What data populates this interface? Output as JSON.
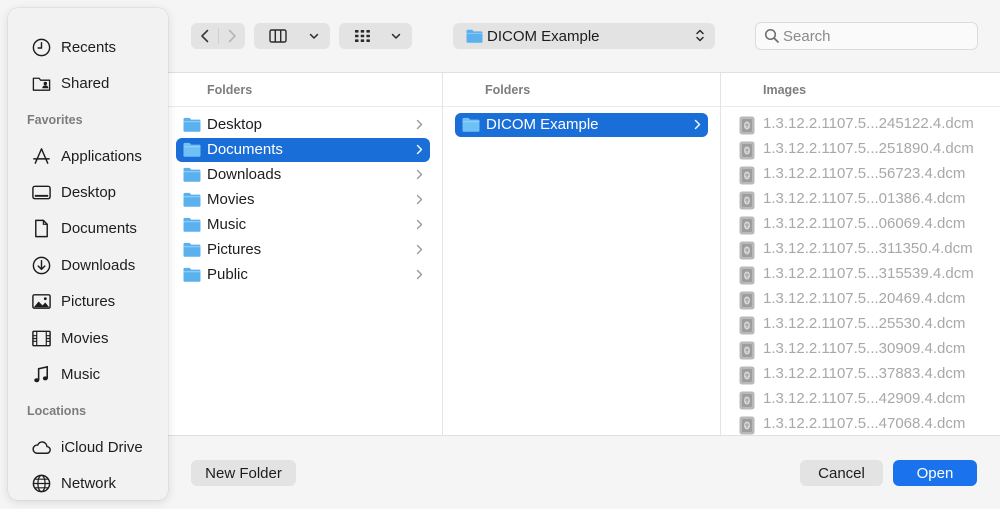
{
  "sidebar": {
    "top_items": [
      {
        "label": "Recents",
        "icon": "clock-icon"
      },
      {
        "label": "Shared",
        "icon": "shared-folder-icon"
      }
    ],
    "favorites_heading": "Favorites",
    "favorites": [
      {
        "label": "Applications",
        "icon": "applications-icon"
      },
      {
        "label": "Desktop",
        "icon": "desktop-icon"
      },
      {
        "label": "Documents",
        "icon": "document-icon"
      },
      {
        "label": "Downloads",
        "icon": "downloads-icon"
      },
      {
        "label": "Pictures",
        "icon": "pictures-icon"
      },
      {
        "label": "Movies",
        "icon": "film-icon"
      },
      {
        "label": "Music",
        "icon": "music-note-icon"
      }
    ],
    "locations_heading": "Locations",
    "locations": [
      {
        "label": "iCloud Drive",
        "icon": "cloud-icon"
      },
      {
        "label": "Network",
        "icon": "globe-icon"
      }
    ]
  },
  "toolbar": {
    "path_label": "DICOM Example",
    "search_placeholder": "Search"
  },
  "columns": {
    "col1": {
      "header": "Folders",
      "items": [
        {
          "label": "Desktop",
          "selected": false
        },
        {
          "label": "Documents",
          "selected": true
        },
        {
          "label": "Downloads",
          "selected": false
        },
        {
          "label": "Movies",
          "selected": false
        },
        {
          "label": "Music",
          "selected": false
        },
        {
          "label": "Pictures",
          "selected": false
        },
        {
          "label": "Public",
          "selected": false
        }
      ]
    },
    "col2": {
      "header": "Folders",
      "items": [
        {
          "label": "DICOM Example",
          "selected": true
        }
      ]
    },
    "col3": {
      "header": "Images",
      "items": [
        "1.3.12.2.1107.5...245122.4.dcm",
        "1.3.12.2.1107.5...251890.4.dcm",
        "1.3.12.2.1107.5...56723.4.dcm",
        "1.3.12.2.1107.5...01386.4.dcm",
        "1.3.12.2.1107.5...06069.4.dcm",
        "1.3.12.2.1107.5...311350.4.dcm",
        "1.3.12.2.1107.5...315539.4.dcm",
        "1.3.12.2.1107.5...20469.4.dcm",
        "1.3.12.2.1107.5...25530.4.dcm",
        "1.3.12.2.1107.5...30909.4.dcm",
        "1.3.12.2.1107.5...37883.4.dcm",
        "1.3.12.2.1107.5...42909.4.dcm",
        "1.3.12.2.1107.5...47068.4.dcm"
      ]
    }
  },
  "buttons": {
    "new_folder": "New Folder",
    "cancel": "Cancel",
    "open": "Open"
  },
  "colors": {
    "accent": "#1a73ec",
    "selection": "#1a6ed8",
    "folder": "#5bb0ee"
  }
}
